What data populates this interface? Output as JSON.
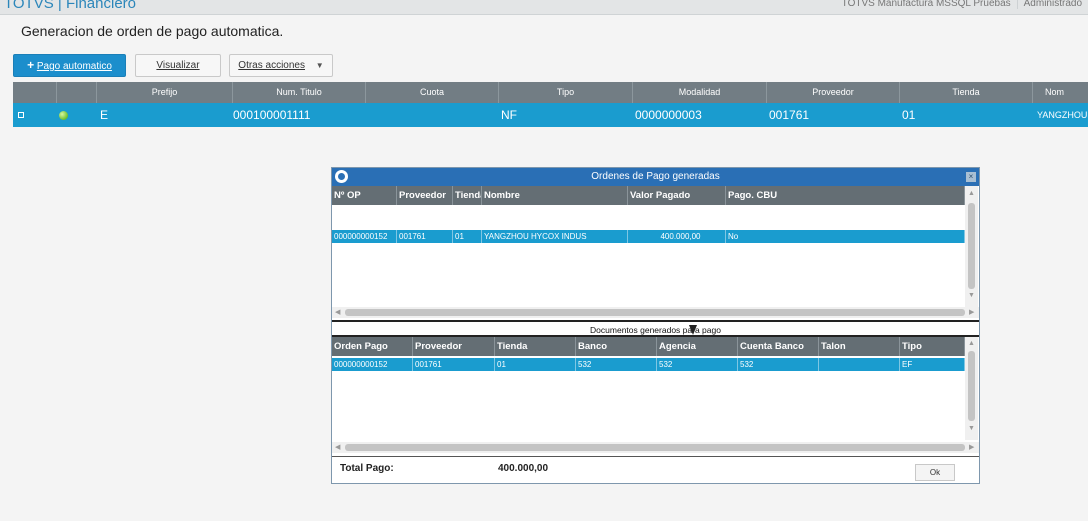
{
  "app": {
    "title": "TOTVS | Financiero"
  },
  "header": {
    "environment": "TOTVS Manufactura MSSQL Pruebas",
    "user": "Administrado"
  },
  "page": {
    "title": "Generacion de orden de pago automatica."
  },
  "toolbar": {
    "primary": {
      "icon": "+",
      "label": "Pago automatico"
    },
    "view": {
      "label": "Visualizar"
    },
    "other": {
      "label": "Otras acciones",
      "arrow": "▼"
    }
  },
  "grid": {
    "columns": {
      "prefijo": "Prefijo",
      "num_titulo": "Num. Titulo",
      "cuota": "Cuota",
      "tipo": "Tipo",
      "modalidad": "Modalidad",
      "proveedor": "Proveedor",
      "tienda": "Tienda",
      "nombre": "Nom"
    },
    "row": {
      "prefijo": "E",
      "num_titulo": "000100001111",
      "cuota": "",
      "tipo": "NF",
      "modalidad": "0000000003",
      "proveedor": "001761",
      "tienda": "01",
      "nombre": "YANGZHOU"
    }
  },
  "dialog": {
    "title": "Ordenes de Pago generadas",
    "close": "×",
    "top": {
      "columns": {
        "op": "Nº OP",
        "proveedor": "Proveedor",
        "tienda": "Tienda",
        "nombre": "Nombre",
        "valor": "Valor Pagado",
        "cbu": "Pago. CBU"
      },
      "row": {
        "op": "000000000152",
        "proveedor": "001761",
        "tienda": "01",
        "nombre": "YANGZHOU HYCOX INDUS",
        "valor": "400.000,00",
        "cbu": "No"
      }
    },
    "section_label": "Documentos generados para pago",
    "bottom": {
      "columns": {
        "orden": "Orden Pago",
        "proveedor": "Proveedor",
        "tienda": "Tienda",
        "banco": "Banco",
        "agencia": "Agencia",
        "cuenta": "Cuenta Banco",
        "talon": "Talon",
        "tipo": "Tipo"
      },
      "row": {
        "orden": "000000000152",
        "proveedor": "001761",
        "tienda": "01",
        "banco": "532",
        "agencia": "532",
        "cuenta": "532",
        "talon": "",
        "tipo": "EF"
      }
    },
    "footer": {
      "total_label": "Total Pago:",
      "total_value": "400.000,00",
      "ok": "Ok"
    }
  },
  "scroll": {
    "up": "▲",
    "down": "▼",
    "left": "◀",
    "right": "▶"
  }
}
